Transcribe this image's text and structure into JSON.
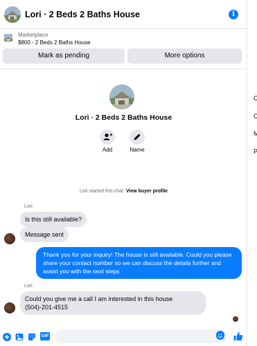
{
  "header": {
    "title": "Lori · 2 Beds 2 Baths House"
  },
  "marketplace": {
    "label": "Marketplace",
    "price_title": "$800 - 2 Beds 2 Baths House",
    "pending_label": "Mark as pending",
    "more_label": "More options"
  },
  "profile": {
    "name": "Lori · 2 Beds 2 Baths House",
    "actions": [
      {
        "label": "Add",
        "icon": "add-person-icon"
      },
      {
        "label": "Name",
        "icon": "pencil-icon"
      }
    ]
  },
  "started": {
    "text": "Lori started this chat.",
    "link": "View buyer profile"
  },
  "messages": [
    {
      "from": "in",
      "sender": "Lori",
      "text": "Is this still available?"
    },
    {
      "from": "in",
      "text": "Message sent"
    },
    {
      "from": "out",
      "text": "Thank you for your inquiry! The house is still available. Could you please share your contact number so we can discuss the details further and assist you with the next steps"
    },
    {
      "from": "in",
      "sender": "Lori",
      "text": "Could you give me a call I  am interested in this house (504)-201-4515"
    }
  ],
  "composer": {
    "value": "",
    "placeholder": "",
    "icons": [
      "plus-icon",
      "image-icon",
      "sticker-icon",
      "gif-icon",
      "emoji-icon",
      "like-icon"
    ],
    "gif_label": "GIF"
  },
  "side_menu": [
    "C",
    "C",
    "M",
    "P"
  ],
  "colors": {
    "accent": "#0a7cff",
    "bubble_in": "#e4e6eb",
    "divider": "#e4e6eb"
  }
}
